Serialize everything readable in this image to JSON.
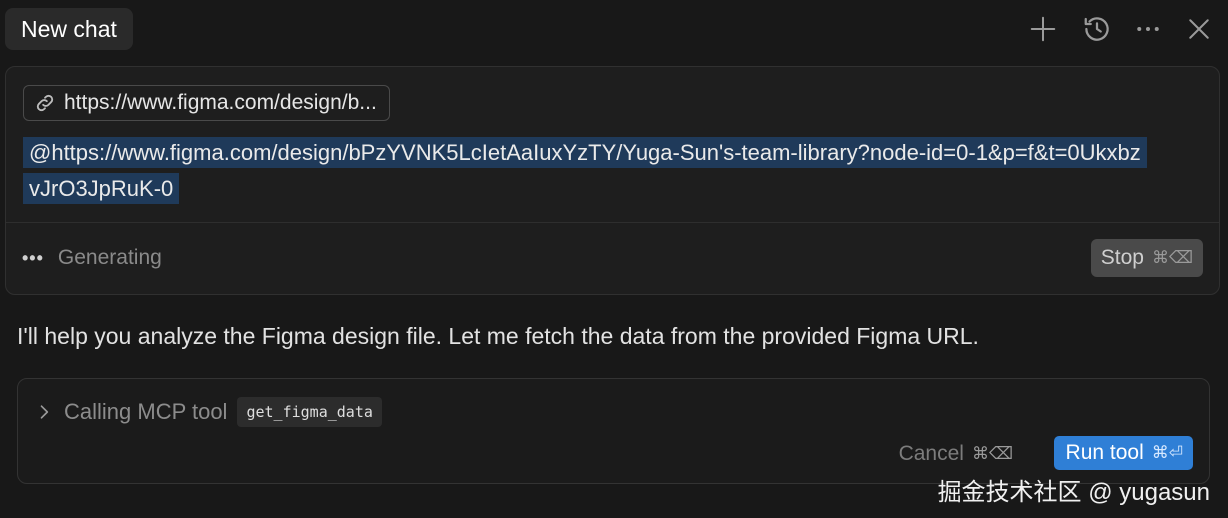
{
  "header": {
    "tab_label": "New chat",
    "icons": [
      "plus-icon",
      "history-icon",
      "more-icon",
      "close-icon"
    ]
  },
  "compose": {
    "url_chip_label": "https://www.figma.com/design/b...",
    "mention_text": "@https://www.figma.com/design/bPzYVNK5LcIetAaIuxYzTY/Yuga-Sun's-team-library?node-id=0-1&p=f&t=0UkxbzvJrO3JpRuK-0",
    "status_text": "Generating",
    "stop_label": "Stop",
    "stop_shortcut": "⌘⌫"
  },
  "assistant": {
    "message": "I'll help you analyze the Figma design file. Let me fetch the data from the provided Figma URL."
  },
  "tool_call": {
    "label": "Calling MCP tool",
    "tool_name": "get_figma_data",
    "cancel_label": "Cancel",
    "cancel_shortcut": "⌘⌫",
    "run_label": "Run tool",
    "run_shortcut": "⌘⏎"
  },
  "watermark": "掘金技术社区 @ yugasun",
  "colors": {
    "background": "#181818",
    "mention_highlight": "#1f3a5a",
    "run_button": "#2f7fd6",
    "stop_button": "#4a4a4a"
  }
}
